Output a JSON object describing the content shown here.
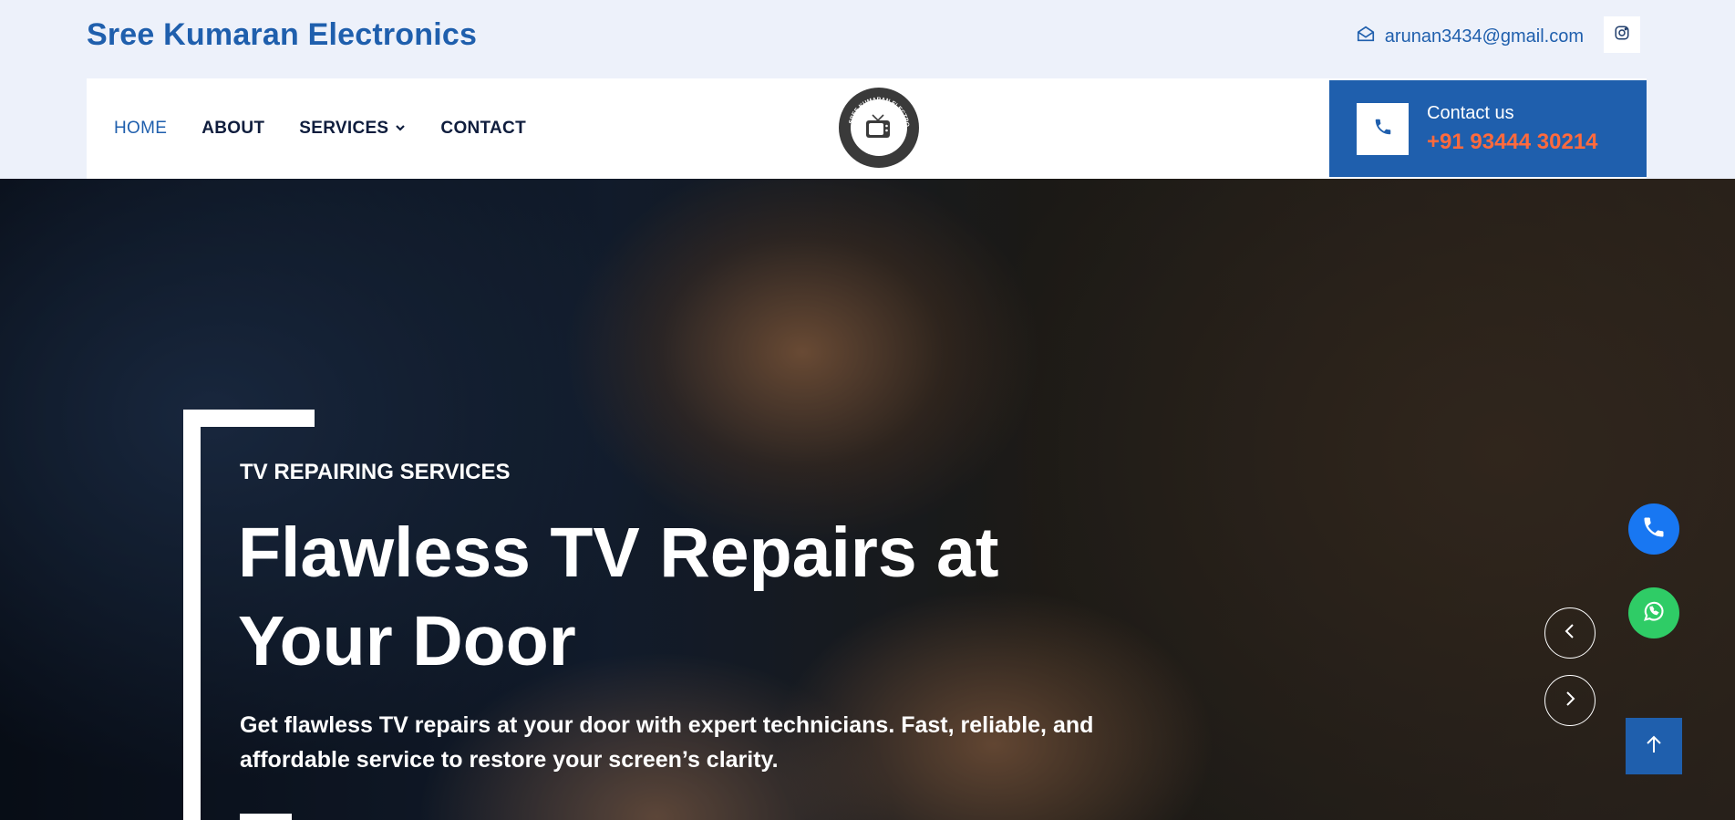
{
  "header": {
    "brand": "Sree Kumaran Electronics",
    "email": "arunan3434@gmail.com",
    "icons": {
      "email": "envelope-open-icon",
      "social": "instagram-icon"
    }
  },
  "nav": {
    "items": [
      {
        "label": "HOME",
        "active": true
      },
      {
        "label": "ABOUT"
      },
      {
        "label": "SERVICES",
        "has_dropdown": true
      },
      {
        "label": "CONTACT"
      }
    ],
    "logo_text": "SREE KUMARAN ELECTRONIC"
  },
  "contact_box": {
    "label": "Contact us",
    "phone": "+91 93444 30214",
    "icon": "phone-icon"
  },
  "hero": {
    "kicker": "TV REPAIRING SERVICES",
    "headline": "Flawless TV Repairs at Your Door",
    "subtitle": "Get flawless TV repairs at your door with expert technicians. Fast, reliable, and affordable service to restore your screen’s clarity."
  },
  "colors": {
    "primary": "#1f5fad",
    "accent": "#ff6a3d",
    "topbar_bg": "#edf1fa",
    "call_fab": "#1877f2",
    "whatsapp_fab": "#2fcc66"
  }
}
